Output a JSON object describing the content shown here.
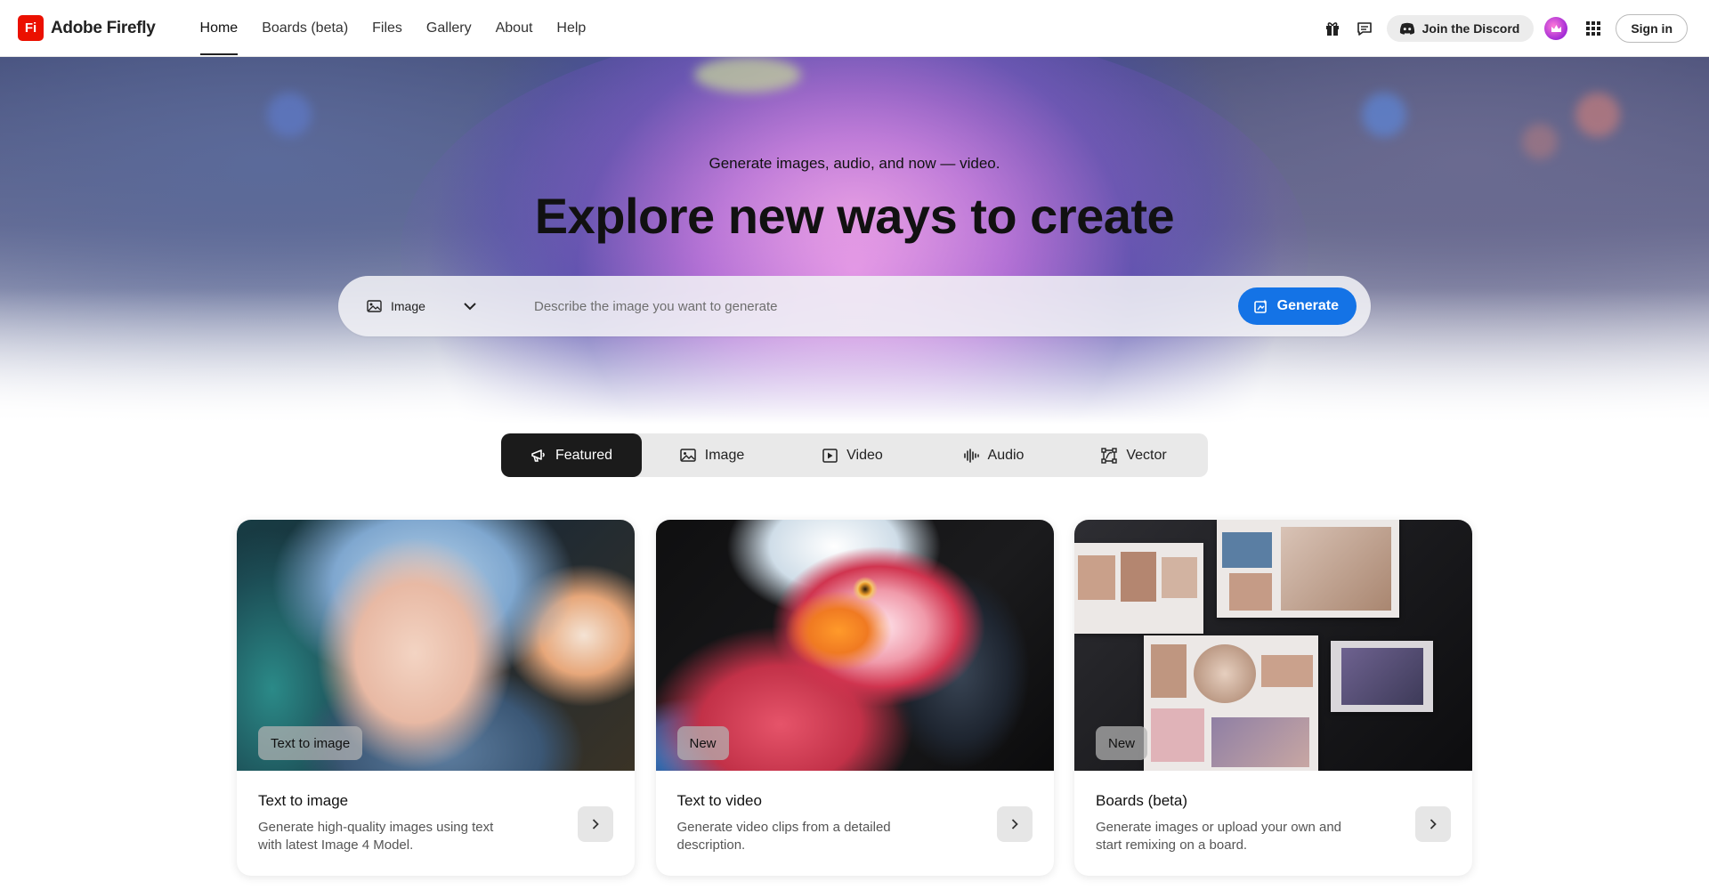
{
  "app": {
    "brand_mark": "Fi",
    "brand_name": "Adobe Firefly"
  },
  "nav": {
    "items": [
      {
        "label": "Home",
        "active": true
      },
      {
        "label": "Boards (beta)",
        "active": false
      },
      {
        "label": "Files",
        "active": false
      },
      {
        "label": "Gallery",
        "active": false
      },
      {
        "label": "About",
        "active": false
      },
      {
        "label": "Help",
        "active": false
      }
    ]
  },
  "header_actions": {
    "gift_icon": "gift-icon",
    "feedback_icon": "chat-bubble-icon",
    "discord_label": "Join the Discord",
    "apps_icon": "grid-icon",
    "signin_label": "Sign in"
  },
  "hero": {
    "subtitle": "Generate images, audio, and now — video.",
    "title": "Explore new ways to create"
  },
  "prompt": {
    "type_value": "Image",
    "placeholder": "Describe the image you want to generate",
    "generate_label": "Generate"
  },
  "tabs": [
    {
      "label": "Featured",
      "icon": "megaphone-icon",
      "active": true
    },
    {
      "label": "Image",
      "icon": "image-icon",
      "active": false
    },
    {
      "label": "Video",
      "icon": "video-icon",
      "active": false
    },
    {
      "label": "Audio",
      "icon": "waveform-icon",
      "active": false
    },
    {
      "label": "Vector",
      "icon": "vector-icon",
      "active": false
    }
  ],
  "cards": [
    {
      "badge": "Text to image",
      "title": "Text to image",
      "description": "Generate high-quality images using text with latest Image 4 Model."
    },
    {
      "badge": "New",
      "title": "Text to video",
      "description": "Generate video clips from a detailed description."
    },
    {
      "badge": "New",
      "title": "Boards (beta)",
      "description": "Generate images or upload your own and start remixing on a board."
    }
  ],
  "colors": {
    "brand_red": "#eb1000",
    "accent_blue": "#1473e6",
    "tab_active_bg": "#1b1b1b"
  }
}
